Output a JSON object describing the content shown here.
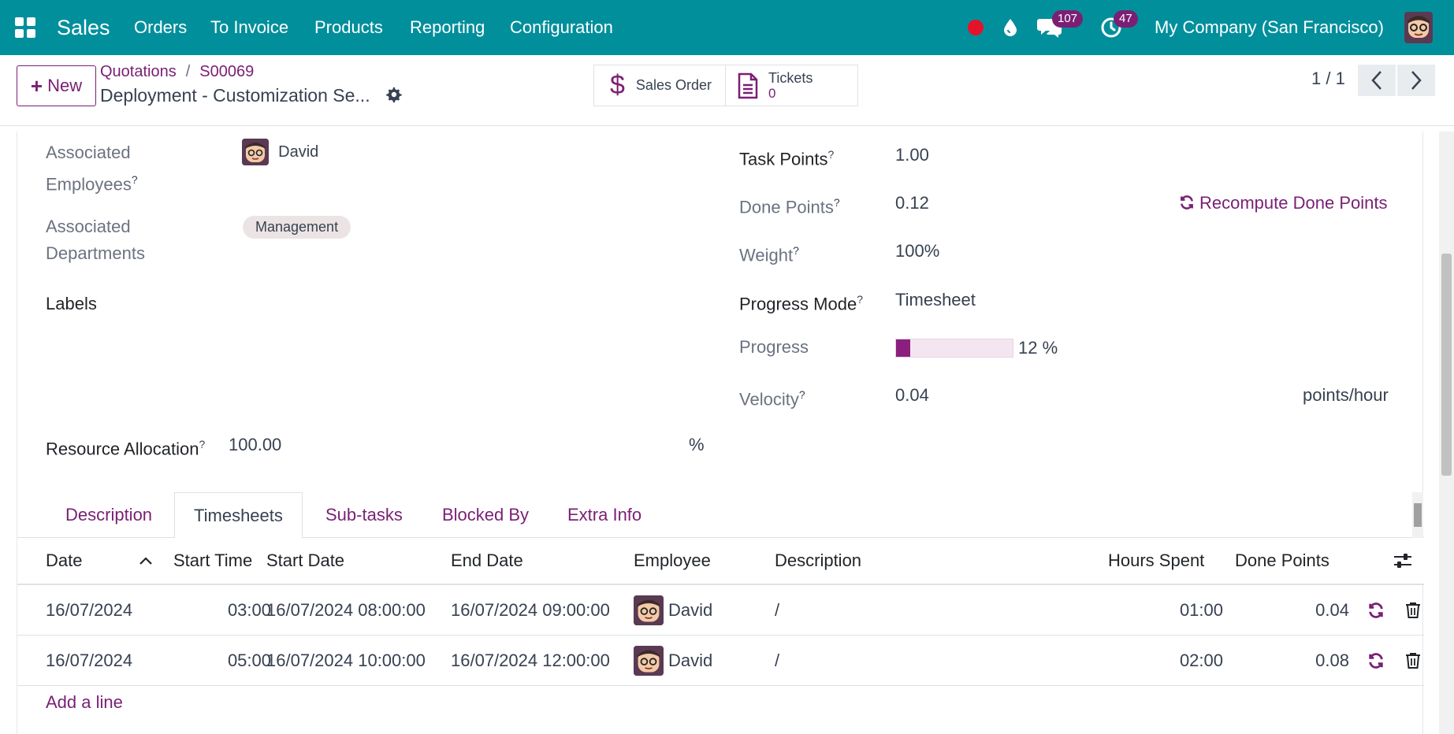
{
  "navbar": {
    "app_name": "Sales",
    "menu": [
      "Orders",
      "To Invoice",
      "Products",
      "Reporting",
      "Configuration"
    ],
    "messages_count": "107",
    "activities_count": "47",
    "company": "My Company (San Francisco)",
    "bg_color": "#018f9c"
  },
  "control": {
    "new_label": "New",
    "breadcrumb": [
      "Quotations",
      "S00069"
    ],
    "record_title": "Deployment - Customization Se...",
    "smart_buttons": {
      "sales_order": "Sales Order",
      "tickets_label": "Tickets",
      "tickets_value": "0"
    },
    "pager": "1 / 1"
  },
  "form": {
    "left": {
      "employees_label_1": "Associated",
      "employees_label_2": "Employees",
      "employee": "David",
      "departments_label_1": "Associated",
      "departments_label_2": "Departments",
      "department_tag": "Management",
      "labels_label": "Labels",
      "resource_label": "Resource Allocation",
      "resource_value": "100.00",
      "resource_unit": "%"
    },
    "right": {
      "task_points_label": "Task Points",
      "task_points": "1.00",
      "done_points_label": "Done Points",
      "done_points": "0.12",
      "recompute_label": "Recompute Done Points",
      "weight_label": "Weight",
      "weight": "100%",
      "progress_mode_label": "Progress Mode",
      "progress_mode": "Timesheet",
      "progress_label": "Progress",
      "progress_percent": 12,
      "progress_text": "12 %",
      "velocity_label": "Velocity",
      "velocity": "0.04",
      "velocity_unit": "points/hour"
    }
  },
  "tabs": [
    "Description",
    "Timesheets",
    "Sub-tasks",
    "Blocked By",
    "Extra Info"
  ],
  "table": {
    "headers": {
      "date": "Date",
      "start_time": "Start Time",
      "start_date": "Start Date",
      "end_date": "End Date",
      "employee": "Employee",
      "description": "Description",
      "hours": "Hours Spent",
      "done_points": "Done Points"
    },
    "rows": [
      {
        "date": "16/07/2024",
        "start_time": "03:00",
        "start_date": "16/07/2024 08:00:00",
        "end_date": "16/07/2024 09:00:00",
        "employee": "David",
        "description": "/",
        "hours": "01:00",
        "done_points": "0.04"
      },
      {
        "date": "16/07/2024",
        "start_time": "05:00",
        "start_date": "16/07/2024 10:00:00",
        "end_date": "16/07/2024 12:00:00",
        "employee": "David",
        "description": "/",
        "hours": "02:00",
        "done_points": "0.08"
      }
    ],
    "add_line": "Add a line"
  },
  "colors": {
    "accent": "#7a1f74",
    "navbar": "#018f9c",
    "record_dot": "#e4132a"
  }
}
